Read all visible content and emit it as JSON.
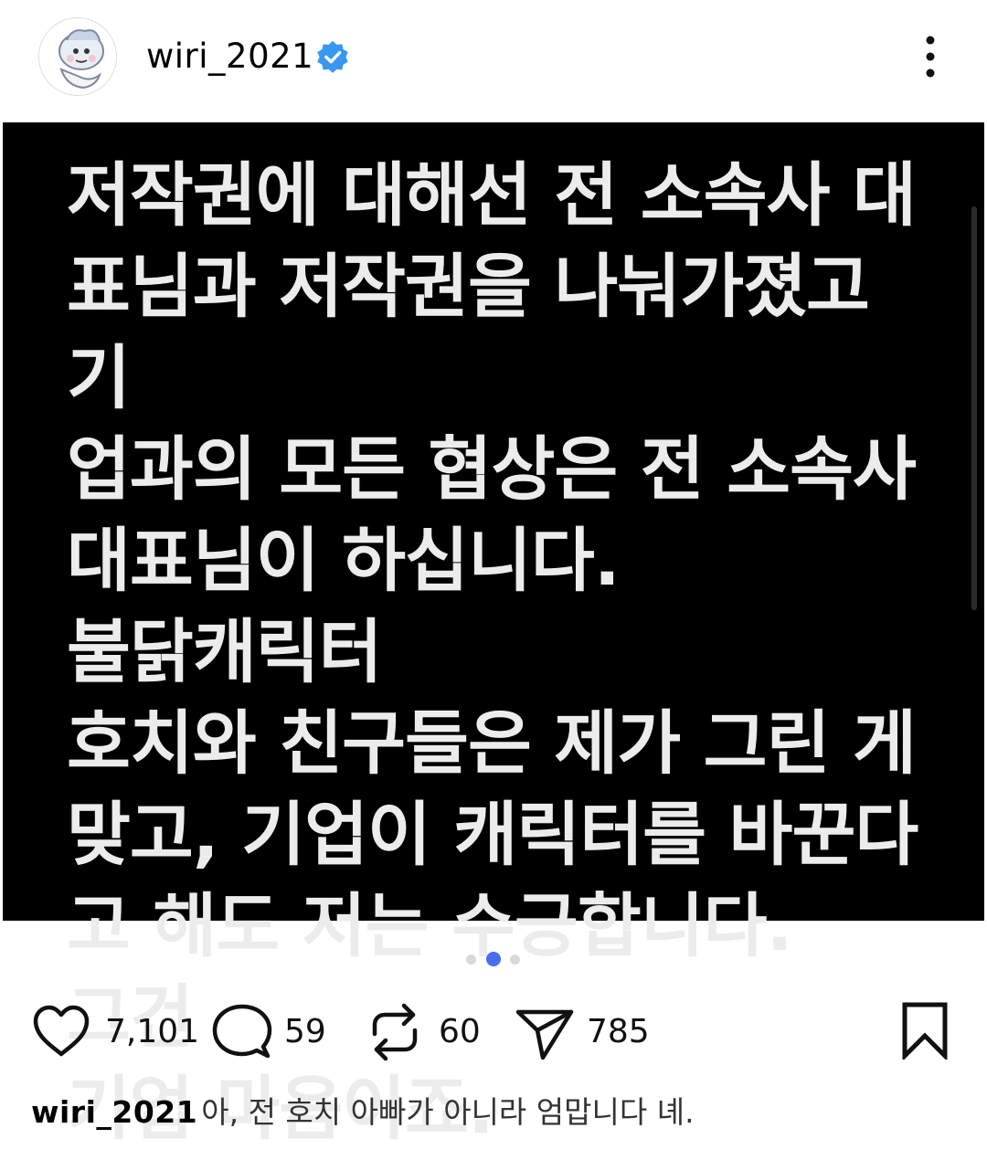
{
  "post": {
    "username": "wiri_2021",
    "verified": true,
    "image_text": "저작권에 대해선 전 소속사 대\n표님과 저작권을 나눠가졌고 기\n업과의 모든 협상은 전 소속사\n대표님이 하십니다. 불닭캐릭터\n호치와 친구들은 제가 그린 게\n맞고, 기업이 캐릭터를 바꾼다\n고 해도 저는 수긍합니다. 그건\n기업 마음이죠.",
    "carousel": {
      "total": 3,
      "active_index": 1
    }
  },
  "actions": {
    "likes": "7,101",
    "comments": "59",
    "reposts": "60",
    "shares": "785"
  },
  "caption": {
    "username": "wiri_2021",
    "text": "아, 전 호치 아빠가 아니라 엄맙니다 녜."
  },
  "icons": {
    "avatar": "avatar-illustration",
    "verified": "verified-badge-icon",
    "more": "more-options-icon",
    "like": "heart-icon",
    "comment": "comment-bubble-icon",
    "repost": "repost-icon",
    "share": "send-icon",
    "save": "bookmark-icon"
  },
  "colors": {
    "verified_badge": "#3897f0",
    "active_dot": "#4a6cf0",
    "inactive_dot": "#d9d9d9",
    "image_background": "#000000",
    "image_text": "#ececec"
  }
}
